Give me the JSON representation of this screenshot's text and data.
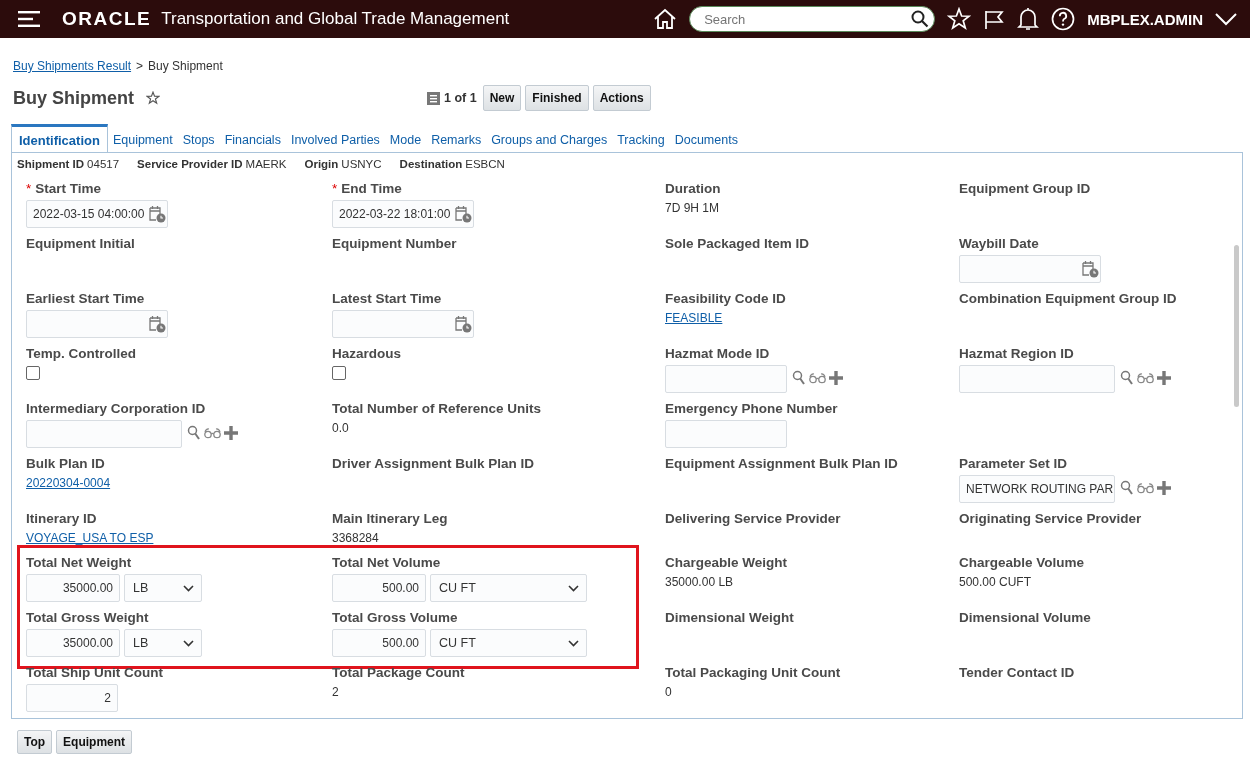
{
  "header": {
    "logo": "ORACLE",
    "app_title": "Transportation and Global Trade Management",
    "search": {
      "placeholder": "Search"
    },
    "user": "MBPLEX.ADMIN"
  },
  "breadcrumb": [
    {
      "kind": "link",
      "text": "Buy Shipments Result"
    },
    {
      "kind": "separator",
      "text": ">"
    },
    {
      "kind": "current",
      "text": "Buy Shipment"
    }
  ],
  "page_title": "Buy Shipment",
  "favorite": false,
  "pager": "1 of 1",
  "toolbar_buttons": [
    "New",
    "Finished",
    "Actions"
  ],
  "tabs": [
    {
      "label": "Identification",
      "selected": true
    },
    {
      "label": "Equipment",
      "selected": false
    },
    {
      "label": "Stops",
      "selected": false
    },
    {
      "label": "Financials",
      "selected": false
    },
    {
      "label": "Involved Parties",
      "selected": false
    },
    {
      "label": "Mode",
      "selected": false
    },
    {
      "label": "Remarks",
      "selected": false
    },
    {
      "label": "Groups and Charges",
      "selected": false
    },
    {
      "label": "Tracking",
      "selected": false
    },
    {
      "label": "Documents",
      "selected": false
    }
  ],
  "summary": [
    {
      "label": "Shipment ID",
      "value": "04517"
    },
    {
      "label": "Service Provider ID",
      "value": "MAERK"
    },
    {
      "label": "Origin",
      "value": "USNYC"
    },
    {
      "label": "Destination",
      "value": "ESBCN"
    }
  ],
  "blocks": [
    {
      "rows": [
        [
          {
            "label": "Start Time",
            "marker": "*",
            "kind": "date",
            "value": "2022-03-15 04:00:00"
          },
          {
            "label": "End Time",
            "marker": "*",
            "kind": "date",
            "value": "2022-03-22 18:01:00"
          },
          {
            "label": "Duration",
            "kind": "text",
            "value": "7D 9H 1M"
          },
          {
            "label": "Equipment Group ID",
            "kind": "none"
          }
        ],
        [
          {
            "label": "Equipment Initial",
            "kind": "none"
          },
          {
            "label": "Equipment Number",
            "kind": "none"
          },
          {
            "label": "Sole Packaged Item ID",
            "kind": "none"
          },
          {
            "label": "Waybill Date",
            "kind": "date"
          }
        ],
        [
          {
            "label": "Earliest Start Time",
            "kind": "date"
          },
          {
            "label": "Latest Start Time",
            "kind": "date"
          },
          {
            "label": "Feasibility Code ID",
            "kind": "link",
            "value": "FEASIBLE"
          },
          {
            "label": "Combination Equipment Group ID",
            "kind": "none"
          }
        ],
        [
          {
            "label": "Temp. Controlled",
            "kind": "checkbox",
            "checked": false
          },
          {
            "label": "Hazardous",
            "kind": "checkbox",
            "checked": false
          },
          {
            "label": "Hazmat Mode ID",
            "kind": "lookup"
          },
          {
            "label": "Hazmat Region ID",
            "kind": "lookup"
          }
        ],
        [
          {
            "label": "Intermediary Corporation ID",
            "kind": "lookup"
          },
          {
            "label": "Total Number of Reference Units",
            "kind": "text",
            "value": "0.0"
          },
          {
            "label": "Emergency Phone Number",
            "kind": "input"
          },
          {
            "kind": "none"
          }
        ],
        [
          {
            "label": "Bulk Plan ID",
            "kind": "link",
            "value": "20220304-0004"
          },
          {
            "label": "Driver Assignment Bulk Plan ID",
            "kind": "none"
          },
          {
            "label": "Equipment Assignment Bulk Plan ID",
            "kind": "none"
          },
          {
            "label": "Parameter Set ID",
            "kind": "lookup",
            "value": "NETWORK ROUTING PAR"
          }
        ],
        [
          {
            "label": "Itinerary ID",
            "kind": "link",
            "value": "VOYAGE_USA TO ESP"
          },
          {
            "label": "Main Itinerary Leg",
            "kind": "text",
            "value": "3368284"
          },
          {
            "label": "Delivering Service Provider",
            "kind": "none"
          },
          {
            "label": "Originating Service Provider",
            "kind": "none"
          }
        ]
      ]
    },
    {
      "highlighted": true,
      "rows": [
        [
          {
            "label": "Total Net Weight",
            "kind": "qty",
            "value": "35000.00",
            "unit": "LB"
          },
          {
            "label": "Total Net Volume",
            "kind": "qty",
            "value": "500.00",
            "unit": "CU FT"
          },
          {
            "label": "Chargeable Weight",
            "kind": "text",
            "value": "35000.00 LB"
          },
          {
            "label": "Chargeable Volume",
            "kind": "text",
            "value": "500.00 CUFT"
          }
        ],
        [
          {
            "label": "Total Gross Weight",
            "kind": "qty",
            "value": "35000.00",
            "unit": "LB"
          },
          {
            "label": "Total Gross Volume",
            "kind": "qty",
            "value": "500.00",
            "unit": "CU FT"
          },
          {
            "label": "Dimensional Weight",
            "kind": "none"
          },
          {
            "label": "Dimensional Volume",
            "kind": "none"
          }
        ]
      ]
    },
    {
      "rows": [
        [
          {
            "label": "Total Ship Unit Count",
            "kind": "input",
            "value": "2"
          },
          {
            "label": "Total Package Count",
            "kind": "text",
            "value": "2"
          },
          {
            "label": "Total Packaging Unit Count",
            "kind": "text",
            "value": "0"
          },
          {
            "label": "Tender Contact ID",
            "kind": "none"
          }
        ]
      ]
    }
  ],
  "footer_buttons": [
    "Top",
    "Equipment"
  ]
}
